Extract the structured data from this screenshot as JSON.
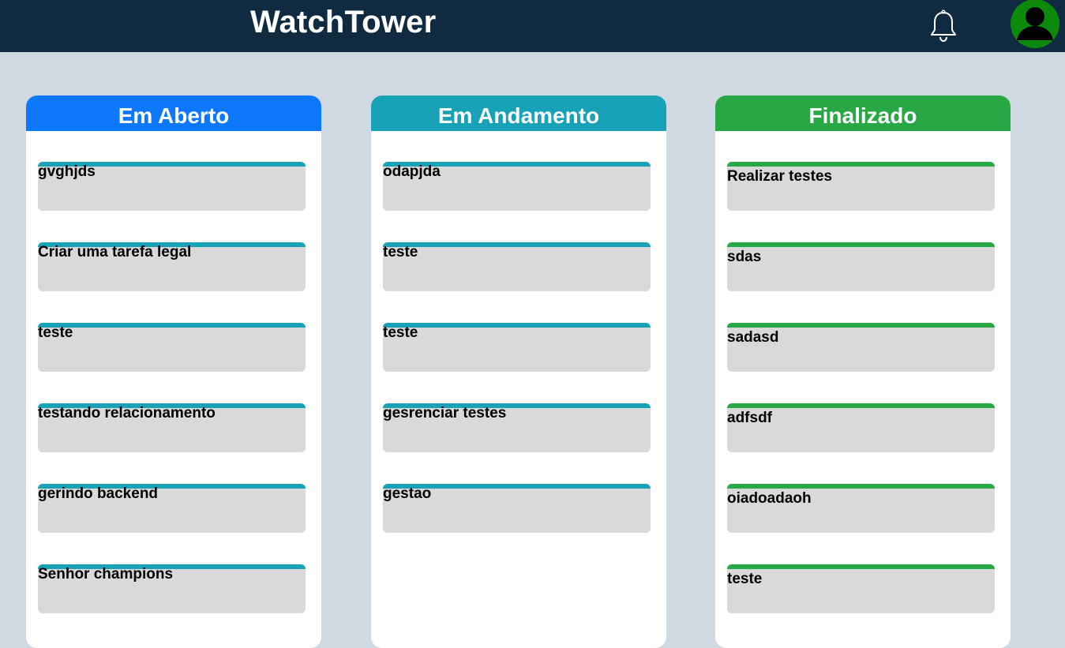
{
  "header": {
    "title": "WatchTower",
    "notification_icon": "bell-icon",
    "avatar_icon": "user-avatar-icon",
    "background_color": "#102a41",
    "avatar_color": "#0b8a0b"
  },
  "page": {
    "background_color": "#cfd9e2"
  },
  "columns": [
    {
      "title": "Em Aberto",
      "header_color": "#0d78fc",
      "bar_color": "#17a2b8",
      "tasks": [
        "gvghjds",
        "Criar uma tarefa legal",
        "teste",
        "testando relacionamento",
        "gerindo backend",
        "Senhor champions"
      ]
    },
    {
      "title": "Em Andamento",
      "header_color": "#17a2b8",
      "bar_color": "#17a2b8",
      "tasks": [
        "odapjda",
        "teste",
        "teste",
        "gesrenciar testes",
        "gestao"
      ]
    },
    {
      "title": "Finalizado",
      "header_color": "#28a745",
      "bar_color": "#28a745",
      "tasks": [
        "Realizar testes",
        "sdas",
        "sadasd",
        "adfsdf",
        "oiadoadaoh",
        "teste"
      ]
    }
  ]
}
